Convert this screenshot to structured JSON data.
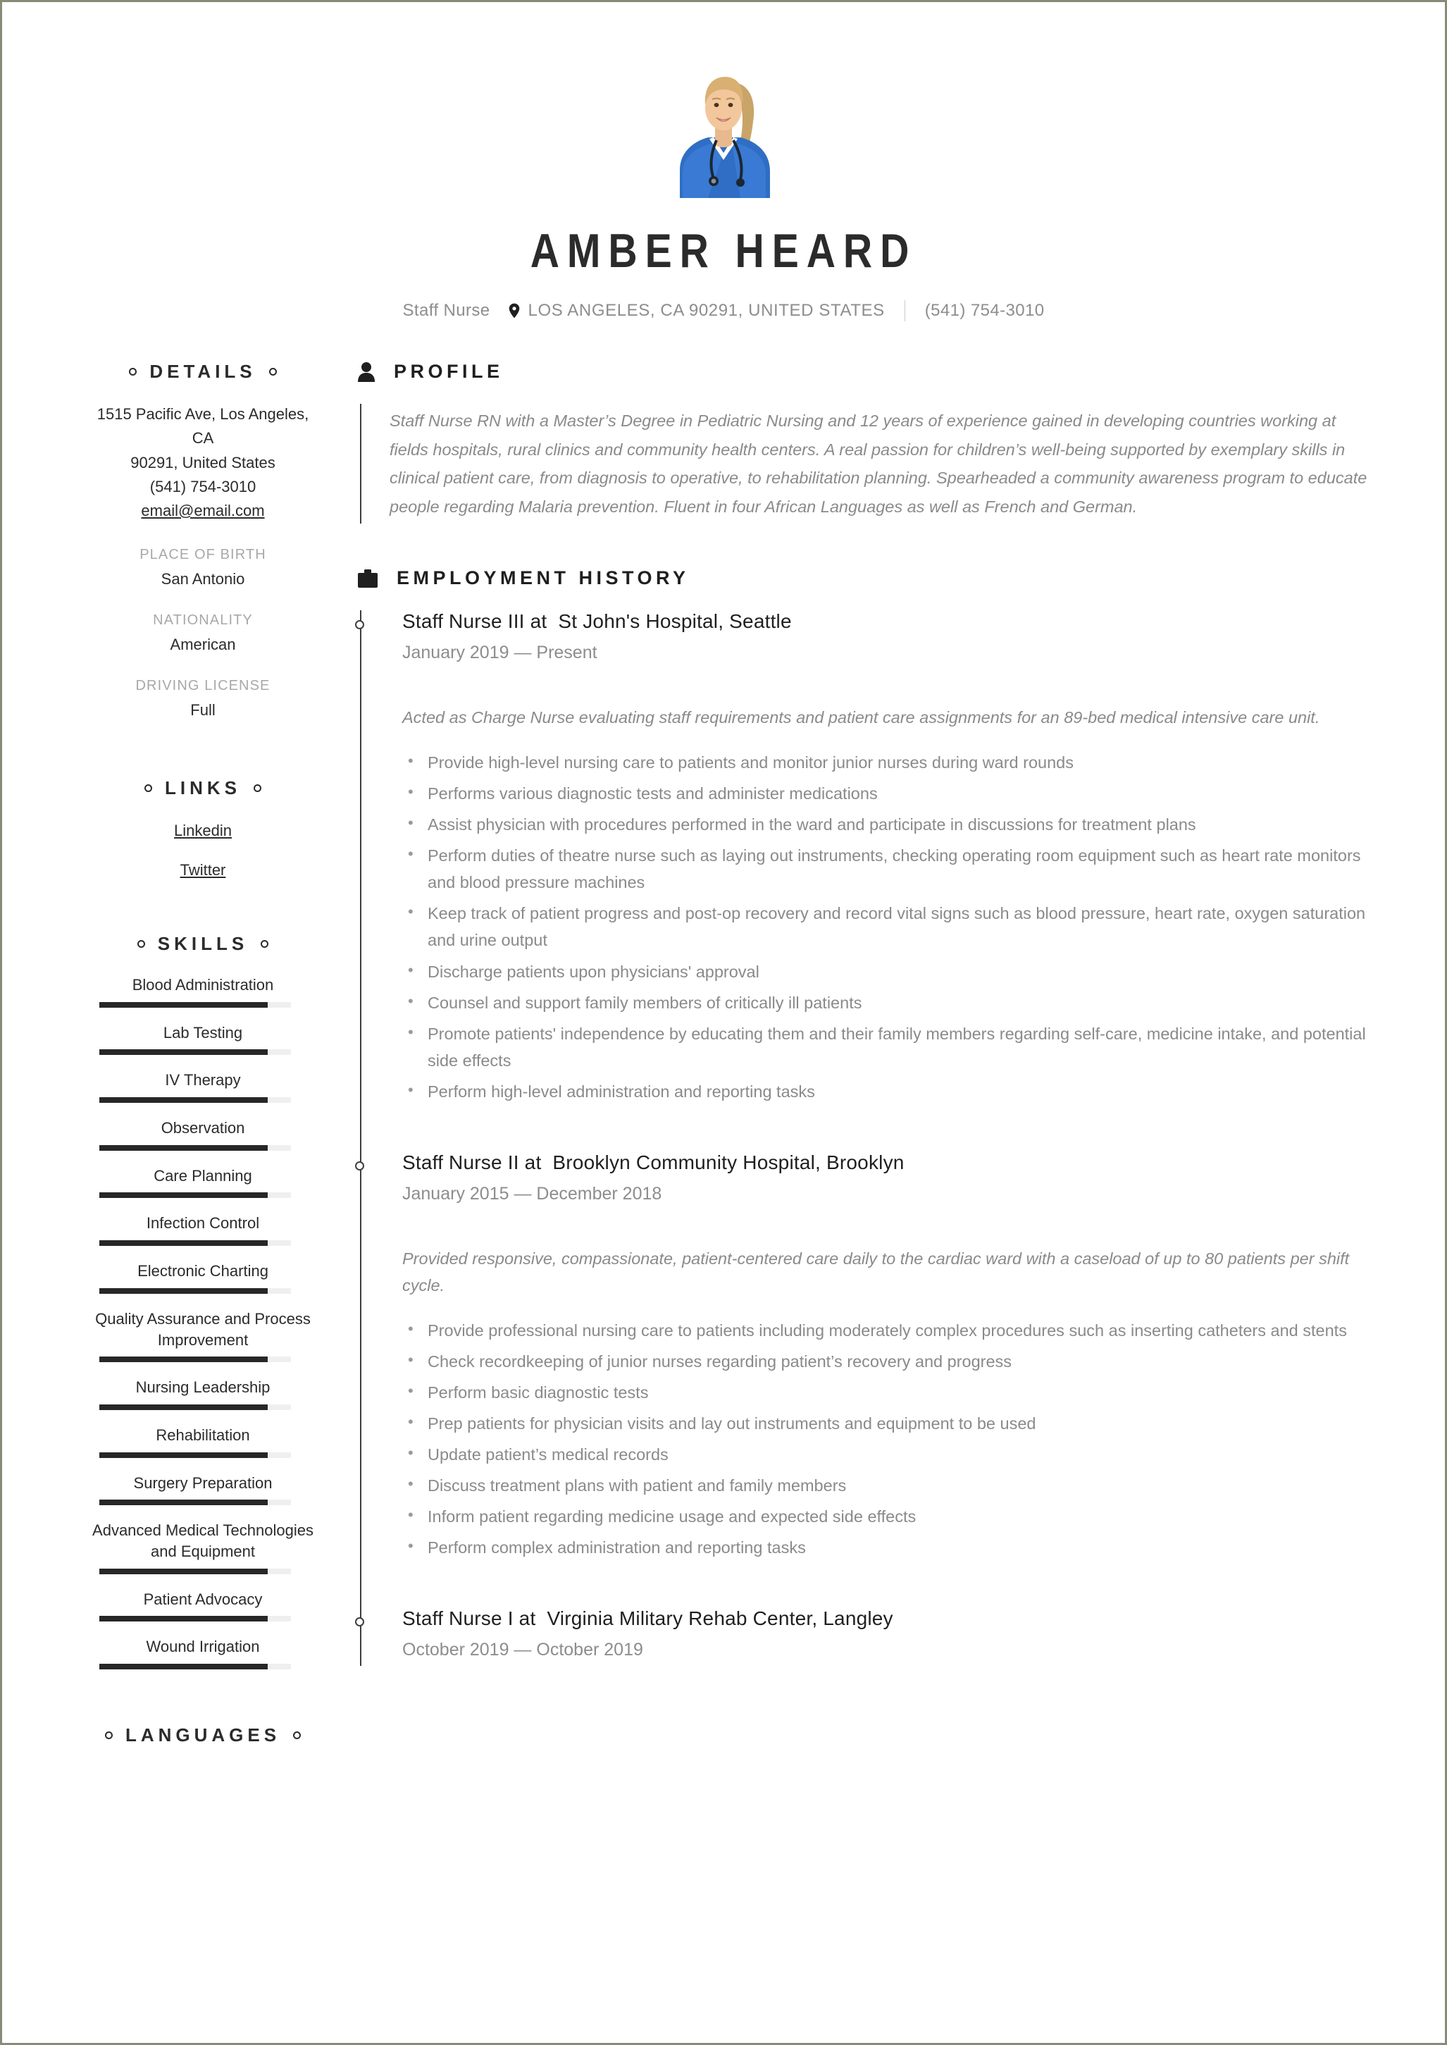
{
  "header": {
    "avatar_alt": "nurse-photo",
    "full_name": "AMBER HEARD",
    "job_title": "Staff Nurse",
    "location": "LOS ANGELES, CA 90291, UNITED STATES",
    "phone": "(541) 754-3010",
    "location_icon": "map-pin-icon"
  },
  "sidebar": {
    "details": {
      "title": "DETAILS",
      "address_line1": "1515 Pacific Ave, Los Angeles, CA",
      "address_line2": "90291, United States",
      "phone": "(541) 754-3010",
      "email": "email@email.com",
      "fields": [
        {
          "label": "PLACE OF BIRTH",
          "value": "San Antonio"
        },
        {
          "label": "NATIONALITY",
          "value": "American"
        },
        {
          "label": "DRIVING LICENSE",
          "value": "Full"
        }
      ]
    },
    "links": {
      "title": "LINKS",
      "items": [
        {
          "label": "Linkedin"
        },
        {
          "label": "Twitter"
        }
      ]
    },
    "skills": {
      "title": "SKILLS",
      "items": [
        {
          "name": "Blood Administration",
          "level": 88
        },
        {
          "name": "Lab Testing",
          "level": 88
        },
        {
          "name": "IV Therapy",
          "level": 88
        },
        {
          "name": "Observation",
          "level": 88
        },
        {
          "name": "Care Planning",
          "level": 88
        },
        {
          "name": "Infection Control",
          "level": 88
        },
        {
          "name": "Electronic Charting",
          "level": 88
        },
        {
          "name": "Quality Assurance and Process Improvement",
          "level": 88
        },
        {
          "name": "Nursing Leadership",
          "level": 88
        },
        {
          "name": "Rehabilitation",
          "level": 88
        },
        {
          "name": "Surgery Preparation",
          "level": 88
        },
        {
          "name": "Advanced Medical Technologies and Equipment",
          "level": 88
        },
        {
          "name": "Patient Advocacy",
          "level": 88
        },
        {
          "name": "Wound Irrigation",
          "level": 88
        }
      ]
    },
    "languages": {
      "title": "LANGUAGES"
    }
  },
  "main": {
    "profile": {
      "title": "PROFILE",
      "icon": "person-icon",
      "text": "Staff Nurse RN with a Master’s Degree in Pediatric Nursing and 12 years of experience gained in developing countries working at fields hospitals, rural clinics and community health centers. A real passion for children’s well-being supported by exemplary skills in clinical patient care, from diagnosis to operative, to rehabilitation planning. Spearheaded a community awareness program to educate people regarding Malaria prevention. Fluent in four African Languages as well as French and German."
    },
    "employment": {
      "title": "EMPLOYMENT HISTORY",
      "icon": "briefcase-icon",
      "jobs": [
        {
          "role": "Staff Nurse III at",
          "company": "St John's Hospital, Seattle",
          "dates": "January 2019 — Present",
          "summary": "Acted as Charge Nurse evaluating staff requirements and patient care assignments for an 89-bed medical intensive care unit.",
          "bullets": [
            "Provide high-level nursing care to patients and monitor junior nurses during ward rounds",
            "Performs various diagnostic tests and administer medications",
            "Assist physician with procedures performed in the ward and participate in discussions for treatment plans",
            "Perform duties of theatre nurse such as laying out instruments, checking operating room equipment such as heart rate monitors and blood pressure machines",
            "Keep track of patient progress and post-op recovery and record vital signs such as blood pressure, heart rate, oxygen saturation and urine output",
            "Discharge patients upon physicians' approval",
            "Counsel and support family members of critically ill patients",
            "Promote patients' independence by educating them and their family members regarding self-care, medicine intake, and potential side effects",
            "Perform high-level administration and reporting tasks"
          ]
        },
        {
          "role": "Staff Nurse II at",
          "company": "Brooklyn Community Hospital, Brooklyn",
          "dates": "January 2015 — December 2018",
          "summary": "Provided responsive, compassionate, patient-centered care daily to the cardiac ward with a caseload of up to 80 patients per shift cycle.",
          "bullets": [
            "Provide professional nursing care to patients including moderately complex procedures such as inserting catheters and stents",
            "Check recordkeeping of junior nurses regarding patient’s recovery and progress",
            "Perform basic diagnostic tests",
            "Prep patients for physician visits and lay out instruments and equipment to be used",
            "Update patient’s medical records",
            "Discuss treatment plans with patient and family members",
            "Inform patient regarding medicine usage and expected side effects",
            "Perform complex administration and reporting tasks"
          ]
        },
        {
          "role": "Staff Nurse I at",
          "company": "Virginia Military Rehab Center, Langley",
          "dates": "October 2019 — October 2019",
          "summary": "",
          "bullets": []
        }
      ]
    }
  },
  "colors": {
    "text_dark": "#1f1f1f",
    "text_muted": "#8a8a8a",
    "label_gray": "#a8a8a8",
    "bar_fill": "#272727",
    "bar_track": "#efefef",
    "page_border": "#8a8a78"
  }
}
